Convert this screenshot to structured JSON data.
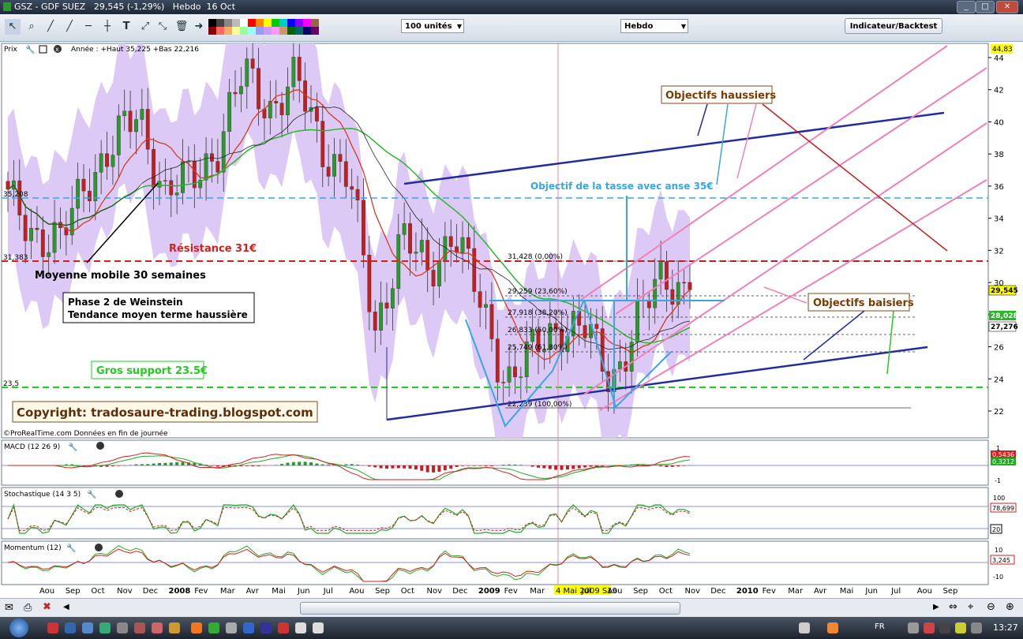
{
  "window": {
    "title": "GSZ - GDF SUEZ   29,545 (-1,29%)   Hebdo  16 Oct"
  },
  "toolbar": {
    "units": "100 unités",
    "period": "Hebdo",
    "indicator_button": "Indicateur/Backtest"
  },
  "colors": {
    "price_up": "#2a9a2a",
    "price_down": "#c22020",
    "mm30": "#2bb52b",
    "mm_red": "#d83a1a",
    "band": "#ddc9f5",
    "resistance": "#d22020",
    "support": "#22cc22",
    "objective": "#3aa6e0",
    "channel_blue": "#232d9c",
    "channel_pink": "#ee82b8"
  },
  "price_panel": {
    "header": "Prix",
    "info": "Année : +Haut 35,225 +Bas 22,216",
    "footer": "©ProRealTime.com  Données en fin de journée",
    "copyright": "Copyright: tradosaure-trading.blogspot.com",
    "annotations": {
      "objectifs_haussiers": "Objectifs haussiers",
      "objectifs_baisiers": "Objectifs baisiers",
      "tasse": "Objectif de la tasse avec anse 35€",
      "resistance": "Résistance 31€",
      "moyenne": "Moyenne mobile 30 semaines",
      "phase_line1": "Phase 2 de Weinstein",
      "phase_line2": "Tendance moyen terme haussière",
      "support": "Gros support 23.5€"
    },
    "left_labels": {
      "l35": "35,208",
      "l31": "31,383",
      "l23": "23,5"
    },
    "fib_labels": [
      "31,428 (0,00%)",
      "29,259 (23,60%)",
      "27,918 (38,20%)",
      "26,833 (50,00%)",
      "25,749 (61,80%)",
      "22,239 (100,00%)"
    ],
    "right_tags": {
      "top": "44,83",
      "price": "29,545",
      "mm_green": "28,028",
      "mm_black": "27,276"
    }
  },
  "macd_panel": {
    "title": "MACD (12 26 9)",
    "right_tags": {
      "a": "0,5436",
      "b": "0,3212"
    },
    "axis": [
      "1",
      "-1"
    ]
  },
  "stoch_panel": {
    "title": "Stochastique (14 3 5)",
    "right_tags": {
      "a": "78,699",
      "b": "20"
    },
    "axis": [
      "100"
    ]
  },
  "momentum_panel": {
    "title": "Momentum (12)",
    "right_tags": {
      "a": "3,245"
    },
    "axis": [
      "10",
      "-10"
    ]
  },
  "x_axis": {
    "labels": [
      "Aou",
      "Sep",
      "Oct",
      "Nov",
      "Dec",
      "2008",
      "Fev",
      "Mar",
      "Avr",
      "Mai",
      "Jun",
      "Jul",
      "Aou",
      "Sep",
      "Oct",
      "Nov",
      "Dec",
      "2009",
      "Fev",
      "Mar",
      "4 Mai 2009 S19",
      "Jul",
      "Aou",
      "Sep",
      "Oct",
      "Nov",
      "Dec",
      "2010",
      "Fev",
      "Mar",
      "Avr",
      "Mai",
      "Jun",
      "Jul",
      "Aou",
      "Sep"
    ]
  },
  "taskbar": {
    "lang": "FR",
    "time": "13:27"
  },
  "chart_data": {
    "type": "candlestick",
    "title": "GSZ - GDF SUEZ",
    "period": "Hebdo",
    "ylim": [
      21,
      45
    ],
    "yticks": [
      22,
      24,
      26,
      28,
      30,
      32,
      34,
      36,
      38,
      40,
      42,
      44
    ],
    "ohlc_close_path": [
      [
        "2007-08",
        35.1
      ],
      [
        "2007-09",
        33.2
      ],
      [
        "2007-10",
        32.4
      ],
      [
        "2007-11",
        36.5
      ],
      [
        "2007-12",
        38.5
      ],
      [
        "2008-01",
        40.5
      ],
      [
        "2008-02",
        35.5
      ],
      [
        "2008-03",
        36.4
      ],
      [
        "2008-04",
        38.5
      ],
      [
        "2008-05",
        43.0
      ],
      [
        "2008-06",
        41.0
      ],
      [
        "2008-07",
        42.5
      ],
      [
        "2008-08",
        38.5
      ],
      [
        "2008-09",
        36.5
      ],
      [
        "2008-10",
        27.0
      ],
      [
        "2008-11",
        33.0
      ],
      [
        "2008-12",
        30.5
      ],
      [
        "2009-01",
        33.5
      ],
      [
        "2009-02",
        28.5
      ],
      [
        "2009-03",
        24.0
      ],
      [
        "2009-04",
        25.5
      ],
      [
        "2009-05",
        27.5
      ],
      [
        "2009-06",
        27.0
      ],
      [
        "2009-07",
        24.0
      ],
      [
        "2009-08",
        27.5
      ],
      [
        "2009-09",
        30.5
      ],
      [
        "2009-10",
        29.545
      ]
    ],
    "levels": {
      "resistance": 31.383,
      "support": 23.5,
      "cup_target": 35.208
    },
    "fibonacci": [
      31.428,
      29.259,
      27.918,
      26.833,
      25.749,
      22.239
    ],
    "last": 29.545,
    "change_pct": -1.29,
    "moving_averages": {
      "green": 28.028,
      "black": 27.276
    }
  }
}
